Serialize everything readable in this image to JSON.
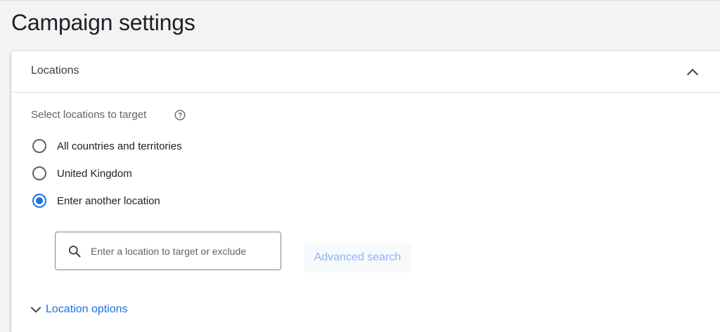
{
  "page": {
    "title": "Campaign settings"
  },
  "locations_panel": {
    "title": "Locations",
    "collapse_icon": "chevron-up-icon",
    "select_label": "Select locations to target",
    "help_icon": "help-circle-icon",
    "options": [
      {
        "label": "All countries and territories",
        "selected": false
      },
      {
        "label": "United Kingdom",
        "selected": false
      },
      {
        "label": "Enter another location",
        "selected": true
      }
    ],
    "search": {
      "placeholder": "Enter a location to target or exclude",
      "value": "",
      "icon": "search-icon"
    },
    "advanced_search_label": "Advanced search",
    "location_options_label": "Location options",
    "location_options_icon": "chevron-down-icon"
  },
  "colors": {
    "accent": "#1a73e8",
    "link_disabled": "#8ab4f8",
    "background": "#f1f3f4"
  }
}
